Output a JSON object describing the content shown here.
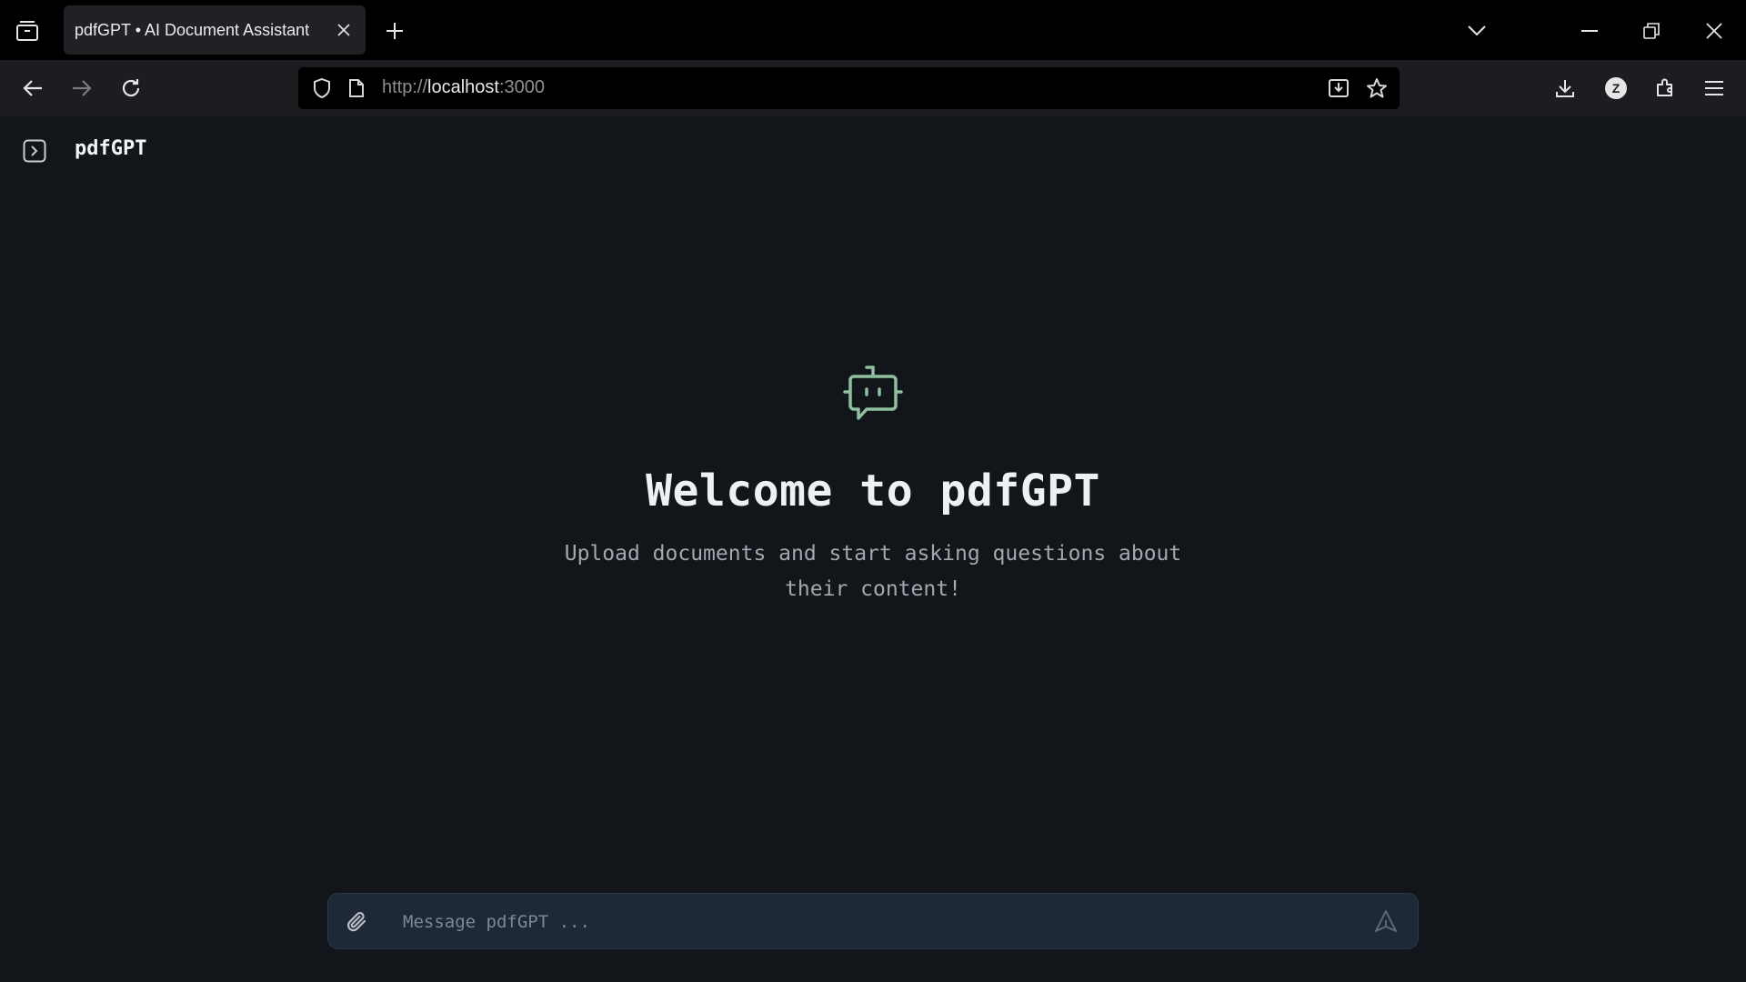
{
  "browser": {
    "tab_title": "pdfGPT • AI Document Assistant",
    "url_scheme": "http://",
    "url_host": "localhost",
    "url_port": ":3000",
    "profile_initial": "Z"
  },
  "app": {
    "title": "pdfGPT",
    "welcome_title": "Welcome to pdfGPT",
    "welcome_subtitle": "Upload documents and start asking questions about their content!",
    "composer_placeholder": "Message pdfGPT ...",
    "accent_color": "#8fbf9f"
  }
}
